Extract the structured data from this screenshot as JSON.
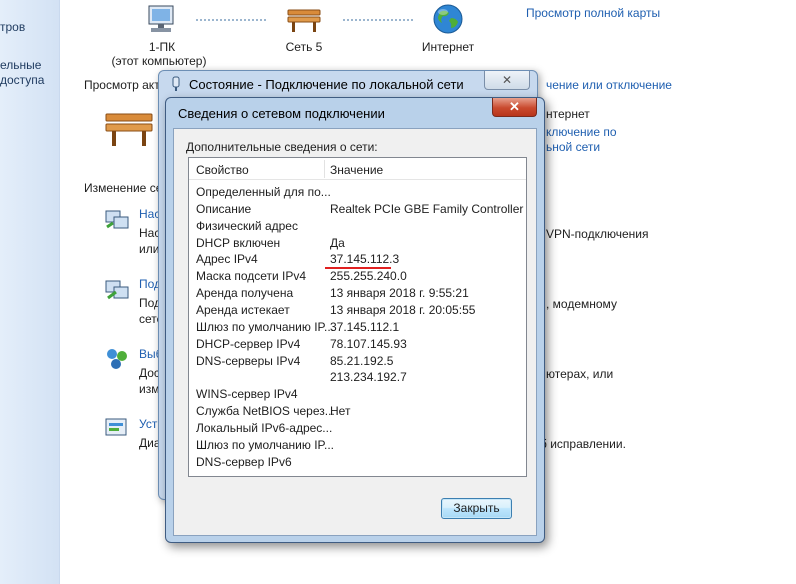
{
  "left_pane": {
    "line1": "тров",
    "line2": "ельные",
    "line3": "доступа"
  },
  "network_map": {
    "pc_label": "1-ПК",
    "pc_sublabel": "(этот компьютер)",
    "network_label": "Сеть  5",
    "internet_label": "Интернет",
    "full_map_link": "Просмотр полной карты"
  },
  "background": {
    "view_active": "Просмотр акт",
    "connect_link": "чение или отключение",
    "internet_frag": "нтернет",
    "lan_link1": "ключение по",
    "lan_link2": "ьной сети",
    "change_settings": "Изменение се",
    "items": [
      {
        "title": "Наст",
        "l1": "Наст",
        "l2": "или",
        "tail": "VPN-подключения"
      },
      {
        "title": "Под",
        "l1": "Под",
        "l2": "сете",
        "tail": ", модемному"
      },
      {
        "title": "Выб",
        "l1": "Дост",
        "l2": "изме",
        "tail": "ютерах, или"
      },
      {
        "title": "Устр",
        "l1": "Диаг",
        "l2": "",
        "tail": "б исправлении."
      }
    ]
  },
  "outer_window": {
    "title": "Состояние - Подключение по локальной сети",
    "close_glyph": "✕"
  },
  "dialog": {
    "title": "Сведения о сетевом подключении",
    "close_glyph": "✕",
    "caption": "Дополнительные сведения о сети:",
    "columns": [
      "Свойство",
      "Значение"
    ],
    "rows": [
      [
        "Определенный для по...",
        ""
      ],
      [
        "Описание",
        "Realtek PCIe GBE Family Controller"
      ],
      [
        "Физический адрес",
        ""
      ],
      [
        "DHCP включен",
        "Да"
      ],
      [
        "Адрес IPv4",
        "37.145.112.3"
      ],
      [
        "Маска подсети IPv4",
        "255.255.240.0"
      ],
      [
        "Аренда получена",
        "13 января 2018 г. 9:55:21"
      ],
      [
        "Аренда истекает",
        "13 января 2018 г. 20:05:55"
      ],
      [
        "Шлюз по умолчанию IP...",
        "37.145.112.1"
      ],
      [
        "DHCP-сервер IPv4",
        "78.107.145.93"
      ],
      [
        "DNS-серверы IPv4",
        "85.21.192.5"
      ],
      [
        "",
        "213.234.192.7"
      ],
      [
        "WINS-сервер IPv4",
        ""
      ],
      [
        "Служба NetBIOS через...",
        "Нет"
      ],
      [
        "Локальный IPv6-адрес...",
        ""
      ],
      [
        "Шлюз по умолчанию IP...",
        ""
      ],
      [
        "DNS-сервер IPv6",
        ""
      ]
    ],
    "close_button": "Закрыть",
    "highlight_color": "#e02020"
  }
}
